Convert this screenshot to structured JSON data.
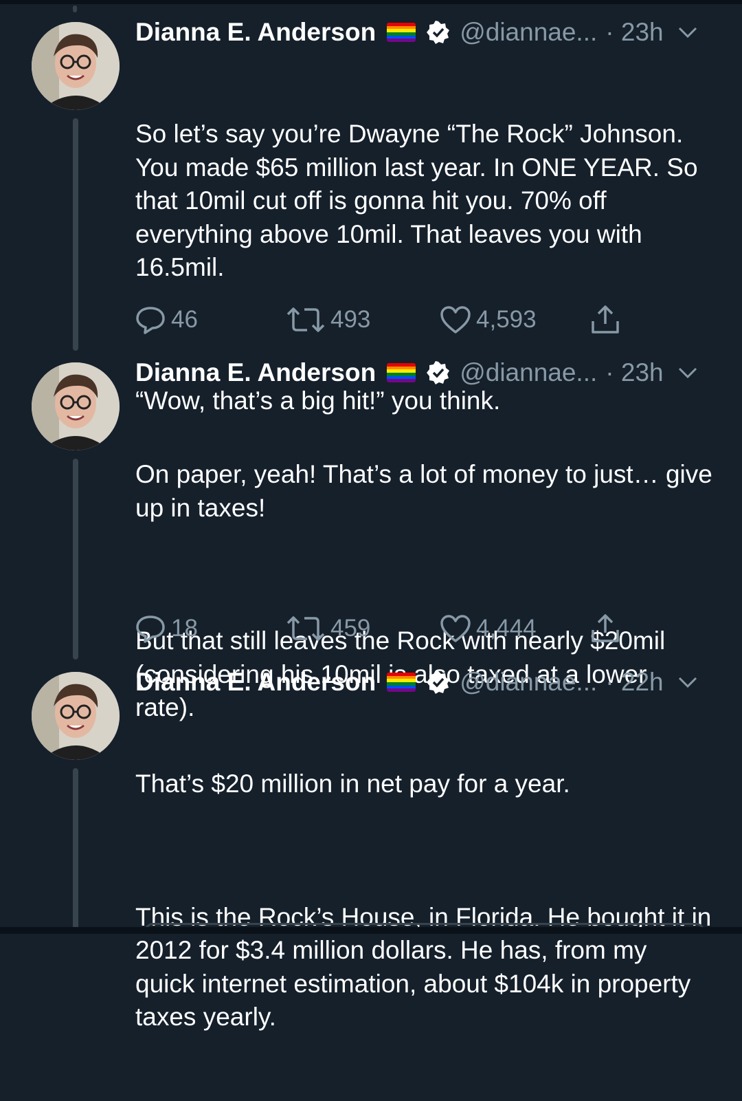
{
  "tweets": [
    {
      "name": "Dianna E. Anderson",
      "handle": "@diannae...",
      "time": "· 23h",
      "paragraphs": [
        "So let’s say you’re Dwayne “The Rock” Johnson. You made $65 million last year. In ONE YEAR. So that 10mil cut off is gonna hit you. 70% off everything above 10mil. That leaves you with 16.5mil.",
        "“Wow, that’s a big hit!” you think."
      ],
      "replies": "46",
      "retweets": "493",
      "likes": "4,593"
    },
    {
      "name": "Dianna E. Anderson",
      "handle": "@diannae...",
      "time": "· 23h",
      "paragraphs": [
        "On paper, yeah! That’s a lot of money to just… give up in taxes!",
        "But that still leaves the Rock with nearly $20mil (considering his 10mil is also taxed at a lower rate)."
      ],
      "replies": "18",
      "retweets": "459",
      "likes": "4,444"
    },
    {
      "name": "Dianna E. Anderson",
      "handle": "@diannae...",
      "time": "· 22h",
      "paragraphs": [
        "That’s $20 million in net pay for a year.",
        "This is the Rock’s House, in Florida. He bought it in 2012 for $3.4 million dollars. He has, from my quick internet estimation, about $104k in property taxes yearly."
      ]
    }
  ],
  "icons": {
    "flag": "rainbow-flag-icon",
    "verified": "verified-badge-icon",
    "caret": "chevron-down-icon",
    "reply": "reply-icon",
    "retweet": "retweet-icon",
    "like": "heart-icon",
    "share": "share-icon"
  },
  "colors": {
    "background": "#15202b",
    "secondary_text": "#8899a6",
    "thread_line": "#38444d"
  }
}
